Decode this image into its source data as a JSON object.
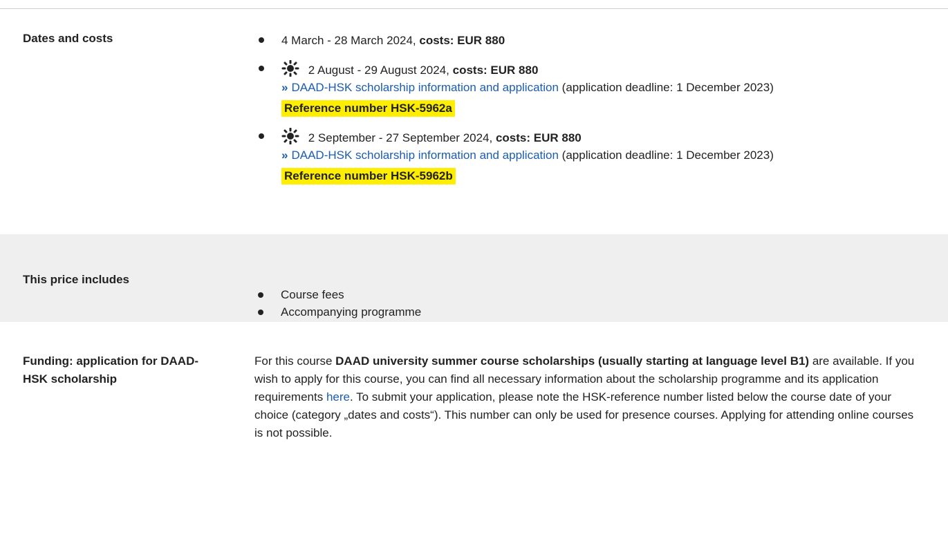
{
  "dates": {
    "label": "Dates and costs",
    "items": [
      {
        "date": "4 March - 28 March 2024,",
        "costs": "costs: EUR 880"
      },
      {
        "date": "2 August - 29 August 2024,",
        "costs": "costs: EUR 880",
        "link": "DAAD-HSK scholarship information and application",
        "deadline": "(application deadline: 1 December 2023)",
        "reference": "Reference number HSK-5962a"
      },
      {
        "date": "2 September - 27 September 2024,",
        "costs": "costs: EUR 880",
        "link": "DAAD-HSK scholarship information and application",
        "deadline": "(application deadline: 1 December 2023)",
        "reference": "Reference number HSK-5962b"
      }
    ]
  },
  "includes": {
    "label": "This price includes",
    "items": [
      "Course fees",
      "Accompanying programme"
    ]
  },
  "funding": {
    "label": "Funding: application for DAAD-HSK scholarship",
    "text_1": "For this course ",
    "bold": "DAAD university summer course scholarships (usually starting at language level B1)",
    "text_2": " are available. If you wish to apply for this course, you can find all necessary information about the scholarship programme and its application requirements ",
    "link": "here",
    "text_3": ". To submit your application, please note the HSK-reference number listed below the course date of your choice (category „dates and costs“). This number can only be used for presence courses. Applying for attending online courses is not possible."
  },
  "colors": {
    "link": "#1a5cb0",
    "highlight": "#ffee00",
    "band": "#efefef"
  },
  "icons": {
    "summer": "sun-icon",
    "link_arrow": "double-chevron-icon"
  }
}
